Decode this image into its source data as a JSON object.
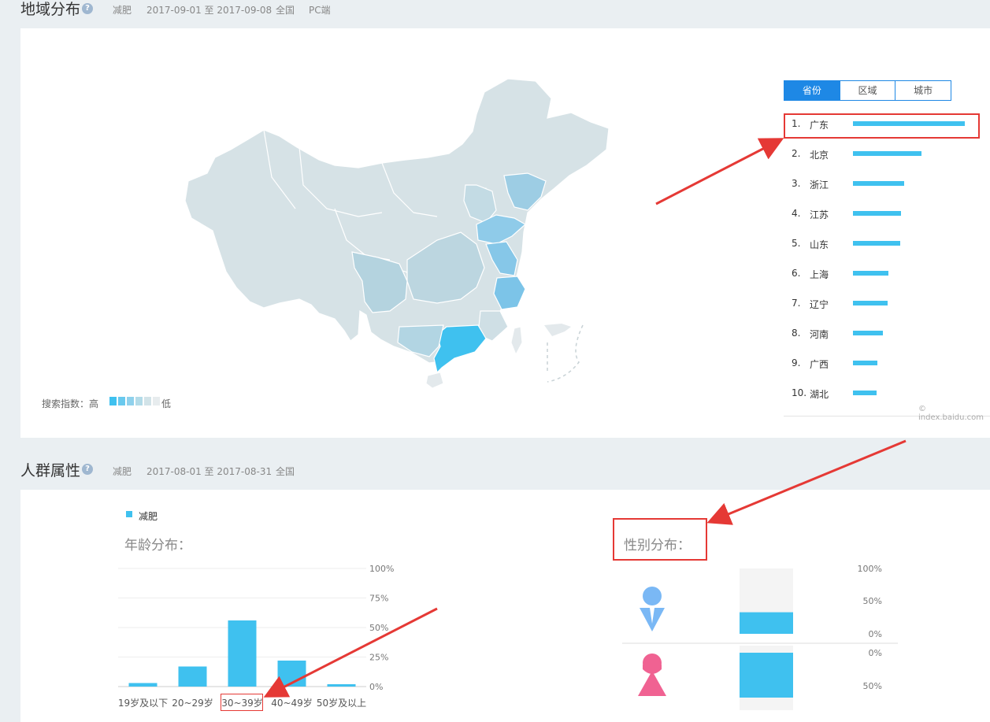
{
  "region": {
    "title": "地域分布",
    "help": "?",
    "meta": [
      "减肥",
      "2017-09-01 至 2017-09-08",
      "全国",
      "PC端"
    ],
    "tabs": [
      "省份",
      "区域",
      "城市"
    ],
    "active_tab": 0,
    "ranking": [
      {
        "rank": "1.",
        "name": "广东",
        "value": 100
      },
      {
        "rank": "2.",
        "name": "北京",
        "value": 61
      },
      {
        "rank": "3.",
        "name": "浙江",
        "value": 46
      },
      {
        "rank": "4.",
        "name": "江苏",
        "value": 43
      },
      {
        "rank": "5.",
        "name": "山东",
        "value": 42
      },
      {
        "rank": "6.",
        "name": "上海",
        "value": 32
      },
      {
        "rank": "7.",
        "name": "辽宁",
        "value": 31
      },
      {
        "rank": "8.",
        "name": "河南",
        "value": 27
      },
      {
        "rank": "9.",
        "name": "广西",
        "value": 22
      },
      {
        "rank": "10.",
        "name": "湖北",
        "value": 21
      }
    ],
    "legend_label": "搜索指数：高",
    "legend_low": "低",
    "legend_colors": [
      "#3fc1ef",
      "#69c9ee",
      "#8fd1ec",
      "#b3dbe8",
      "#d2e3e8",
      "#e7ecee"
    ],
    "watermark": "© index.baidu.com"
  },
  "crowd": {
    "title": "人群属性",
    "help": "?",
    "meta": [
      "减肥",
      "2017-08-01 至 2017-08-31",
      "全国"
    ],
    "legend": "减肥",
    "age_title": "年龄分布：",
    "gender_title": "性别分布：",
    "accent": "#3fc1ef"
  },
  "chart_data": [
    {
      "type": "bar",
      "title": "年龄分布：",
      "categories": [
        "19岁及以下",
        "20~29岁",
        "30~39岁",
        "40~49岁",
        "50岁及以上"
      ],
      "series": [
        {
          "name": "减肥",
          "values": [
            3,
            17,
            56,
            22,
            2
          ]
        }
      ],
      "yticks": [
        "100%",
        "75%",
        "50%",
        "25%",
        "0%"
      ],
      "ylim": [
        0,
        100
      ],
      "grid": true
    },
    {
      "type": "bar",
      "title": "性别分布：",
      "categories": [
        "男",
        "女"
      ],
      "values": [
        33,
        67
      ],
      "male_ticks": [
        "100%",
        "50%",
        "0%"
      ],
      "female_ticks": [
        "0%",
        "50%"
      ]
    }
  ]
}
